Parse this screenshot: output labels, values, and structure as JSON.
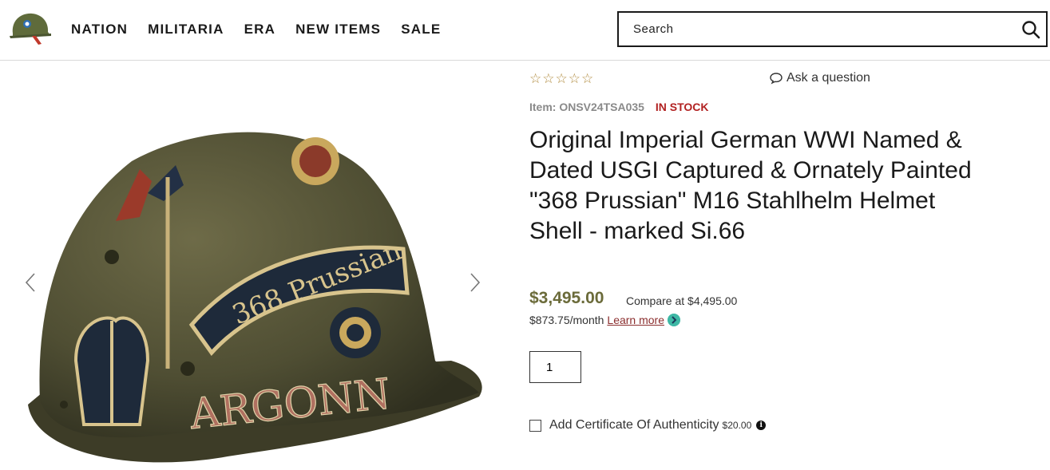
{
  "header": {
    "nav": [
      "NATION",
      "MILITARIA",
      "ERA",
      "NEW ITEMS",
      "SALE"
    ],
    "search_placeholder": "Search",
    "logo_icon": "helmet-logo-icon",
    "search_icon": "search-icon"
  },
  "gallery": {
    "prev_icon": "chevron-left-icon",
    "next_icon": "chevron-right-icon",
    "image_alt": "painted-stahlhelm-helmet"
  },
  "product": {
    "stars": "☆☆☆☆☆",
    "ask_label": "Ask a question",
    "item_label": "Item: ONSV24TSA035",
    "stock_label": "IN STOCK",
    "title": "Original Imperial German WWI Named & Dated USGI Captured & Ornately Painted \"368 Prussian\" M16 Stahlhelm Helmet Shell - marked Si.66",
    "price": "$3,495.00",
    "compare_at": "Compare at $4,495.00",
    "monthly": "$873.75/month",
    "learn_more": "Learn more",
    "quantity": "1",
    "certificate_label": "Add Certificate Of Authenticity",
    "certificate_price": "$20.00",
    "info_glyph": "i"
  },
  "colors": {
    "stock_red": "#b22222",
    "price_olive": "#6b6b3a",
    "learn_link": "#8b2e2e",
    "star_gold": "#b08a3c",
    "sezzle_teal": "#3eb8a5"
  }
}
